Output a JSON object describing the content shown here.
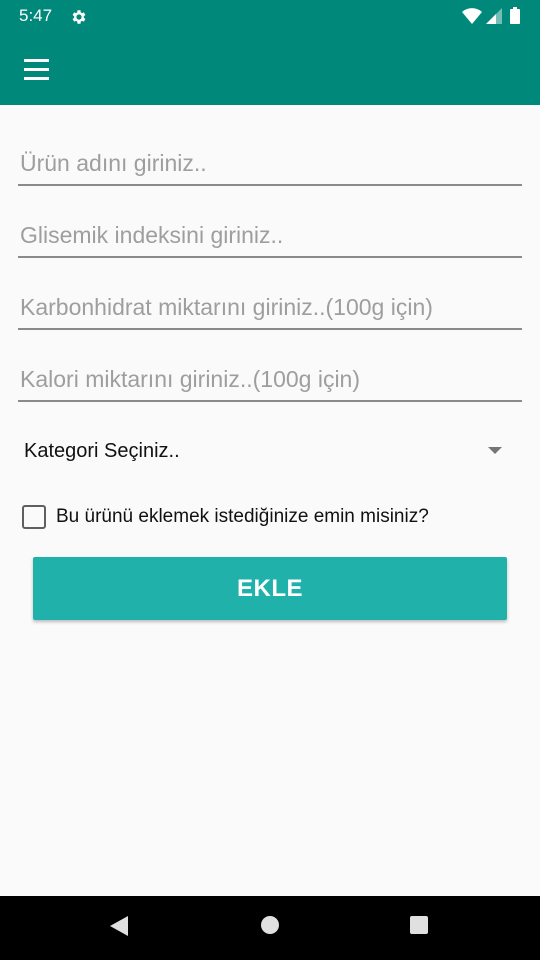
{
  "status_bar": {
    "time": "5:47",
    "icons": [
      "gear-icon",
      "wifi-icon",
      "signal-icon",
      "battery-icon"
    ]
  },
  "app_bar": {
    "color": "#00897b",
    "menu_icon": "hamburger-menu-icon"
  },
  "form": {
    "product_name": {
      "value": "",
      "placeholder": "Ürün adını giriniz.."
    },
    "glycemic_index": {
      "value": "",
      "placeholder": "Glisemik indeksini giriniz.."
    },
    "carbohydrate": {
      "value": "",
      "placeholder": "Karbonhidrat miktarını giriniz..(100g için)"
    },
    "calorie": {
      "value": "",
      "placeholder": "Kalori miktarını giriniz..(100g için)"
    },
    "category_spinner": {
      "selected": "Kategori Seçiniz.."
    },
    "confirm_checkbox": {
      "label": "Bu ürünü eklemek istediğinize emin misiniz?",
      "checked": false
    },
    "add_button": {
      "label": "EKLE",
      "color": "#20b2aa"
    }
  },
  "nav_bar": {
    "icons": [
      "back-icon",
      "home-icon",
      "recents-icon"
    ]
  }
}
